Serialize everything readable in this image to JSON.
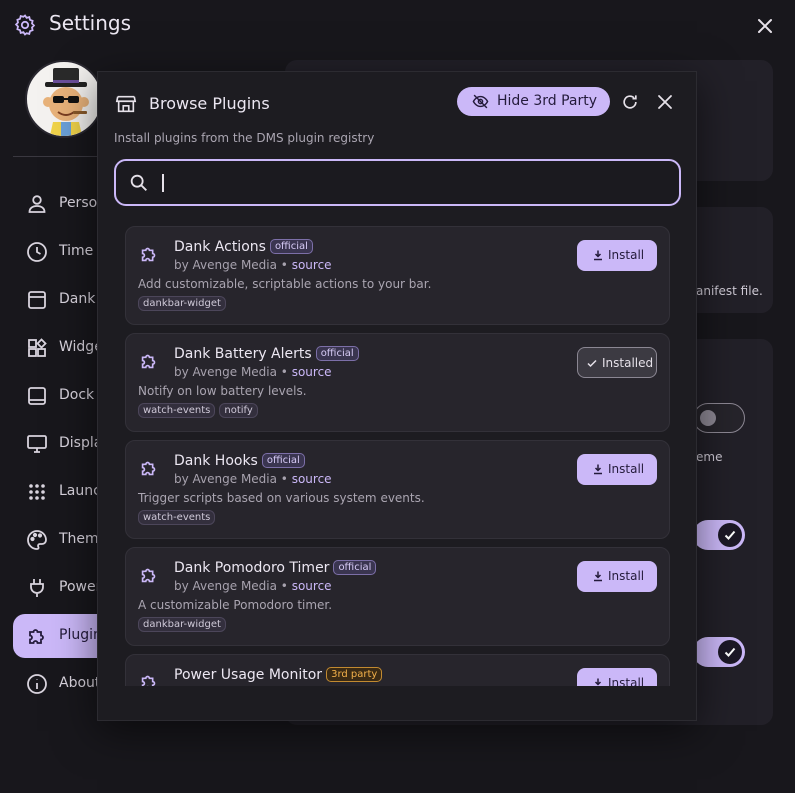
{
  "app": {
    "title": "Settings",
    "icons": {
      "title": "gear-icon",
      "close": "close-icon"
    },
    "colors": {
      "background": "#18171c",
      "accent": "#cbb8f8",
      "surface": "#222028"
    }
  },
  "sidebar": {
    "items": [
      {
        "label": "Personalization",
        "icon": "person-icon"
      },
      {
        "label": "Time & Weather",
        "icon": "clock-icon"
      },
      {
        "label": "Dank Bar",
        "icon": "bar-icon"
      },
      {
        "label": "Widgets",
        "icon": "widgets-icon"
      },
      {
        "label": "Dock",
        "icon": "dock-icon"
      },
      {
        "label": "Displays",
        "icon": "monitor-icon"
      },
      {
        "label": "Launcher",
        "icon": "grid-icon"
      },
      {
        "label": "Theme & Colors",
        "icon": "palette-icon"
      },
      {
        "label": "Power",
        "icon": "plug-icon"
      },
      {
        "label": "Plugins",
        "icon": "puzzle-icon",
        "active": true
      },
      {
        "label": "About",
        "icon": "info-icon"
      }
    ]
  },
  "background_panel": {
    "text_manifest": "anifest file.",
    "text_theme": "eme",
    "toggles": [
      false,
      true,
      true
    ]
  },
  "modal": {
    "title": "Browse Plugins",
    "subtitle": "Install plugins from the DMS plugin registry",
    "hide_button": "Hide 3rd Party",
    "search": {
      "value": "",
      "placeholder": ""
    },
    "icons": {
      "header": "store-icon",
      "hide": "eye-off-icon",
      "refresh": "refresh-icon",
      "close": "close-icon",
      "search": "search-icon"
    },
    "plugins": [
      {
        "name": "Dank Actions",
        "badge": "official",
        "author": "by Avenge Media",
        "sep": " • ",
        "source": "source",
        "description": "Add customizable, scriptable actions to your bar.",
        "tags": [
          "dankbar-widget"
        ],
        "status": "Install",
        "installed": false
      },
      {
        "name": "Dank Battery Alerts",
        "badge": "official",
        "author": "by Avenge Media",
        "sep": " • ",
        "source": "source",
        "description": "Notify on low battery levels.",
        "tags": [
          "watch-events",
          "notify"
        ],
        "status": "Installed",
        "installed": true
      },
      {
        "name": "Dank Hooks",
        "badge": "official",
        "author": "by Avenge Media",
        "sep": " • ",
        "source": "source",
        "description": "Trigger scripts based on various system events.",
        "tags": [
          "watch-events"
        ],
        "status": "Install",
        "installed": false
      },
      {
        "name": "Dank Pomodoro Timer",
        "badge": "official",
        "author": "by Avenge Media",
        "sep": " • ",
        "source": "source",
        "description": "A customizable Pomodoro timer.",
        "tags": [
          "dankbar-widget"
        ],
        "status": "Install",
        "installed": false
      },
      {
        "name": "Power Usage Monitor",
        "badge": "3rd party",
        "author": "",
        "sep": "",
        "source": "",
        "description": "",
        "tags": [],
        "status": "Install",
        "installed": false
      }
    ]
  }
}
